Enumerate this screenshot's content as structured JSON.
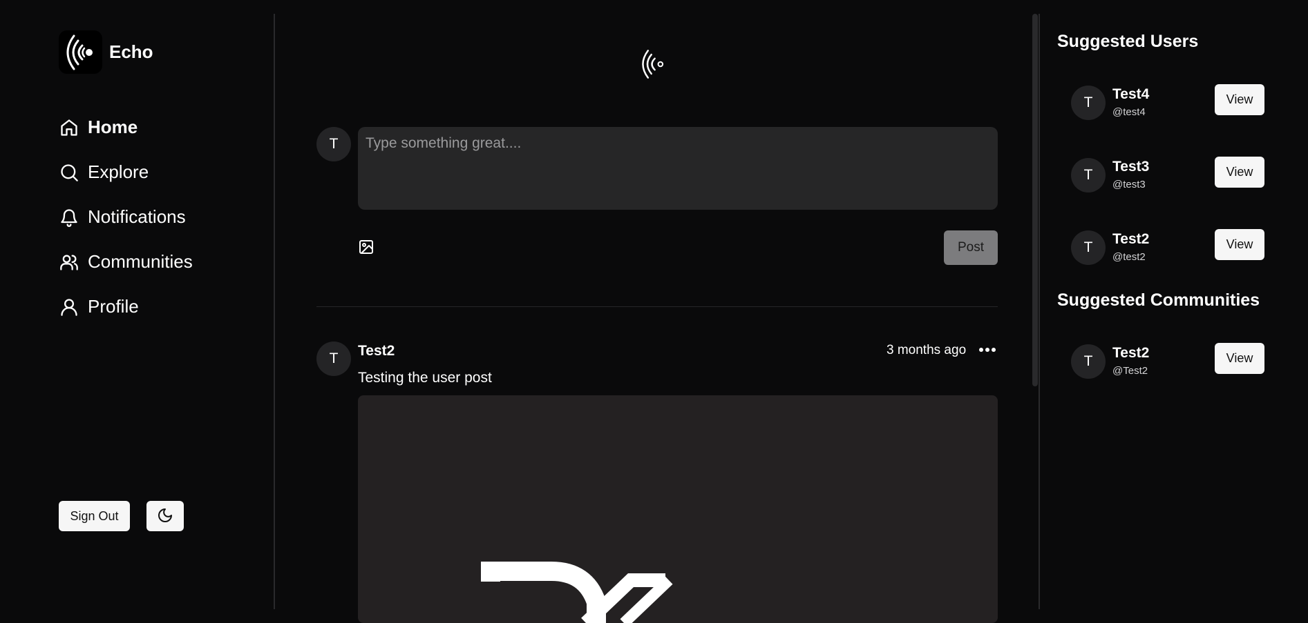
{
  "brand": {
    "name": "Echo"
  },
  "nav": [
    {
      "label": "Home",
      "icon": "home-icon",
      "active": true
    },
    {
      "label": "Explore",
      "icon": "search-icon",
      "active": false
    },
    {
      "label": "Notifications",
      "icon": "bell-icon",
      "active": false
    },
    {
      "label": "Communities",
      "icon": "users-icon",
      "active": false
    },
    {
      "label": "Profile",
      "icon": "user-icon",
      "active": false
    }
  ],
  "footer": {
    "sign_out_label": "Sign Out",
    "theme_icon": "moon-icon"
  },
  "composer": {
    "avatar_initial": "T",
    "placeholder": "Type something great....",
    "image_icon": "image-icon",
    "post_label": "Post"
  },
  "post": {
    "avatar_initial": "T",
    "author": "Test2",
    "time": "3 months ago",
    "text": "Testing the user post",
    "menu_icon": "more-horizontal-icon"
  },
  "suggested_users": {
    "title": "Suggested Users",
    "items": [
      {
        "initial": "T",
        "name": "Test4",
        "handle": "@test4",
        "button": "View"
      },
      {
        "initial": "T",
        "name": "Test3",
        "handle": "@test3",
        "button": "View"
      },
      {
        "initial": "T",
        "name": "Test2",
        "handle": "@test2",
        "button": "View"
      }
    ]
  },
  "suggested_communities": {
    "title": "Suggested Communities",
    "items": [
      {
        "initial": "T",
        "name": "Test2",
        "handle": "@Test2",
        "button": "View"
      }
    ]
  },
  "colors": {
    "background": "#0a0a0b",
    "input_bg": "#262627",
    "button_light": "#f6f6f6",
    "post_button_disabled": "#7c7c7e"
  }
}
